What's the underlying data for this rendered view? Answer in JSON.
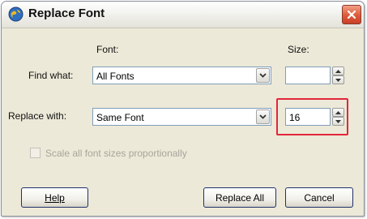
{
  "window": {
    "title": "Replace Font"
  },
  "headers": {
    "font": "Font:",
    "size": "Size:"
  },
  "find": {
    "label": "Find what:",
    "font_value": "All Fonts",
    "size_value": ""
  },
  "replace": {
    "label": "Replace with:",
    "font_value": "Same Font",
    "size_value": "16"
  },
  "options": {
    "scale_label": "Scale all font sizes proportionally",
    "scale_checked": false,
    "scale_enabled": false
  },
  "buttons": {
    "help": "Help",
    "replace_all": "Replace All",
    "cancel": "Cancel"
  },
  "icons": {
    "app": "app-globe-icon",
    "close": "close-icon",
    "dropdown": "chevron-down-icon",
    "spin_up": "spin-up-icon",
    "spin_down": "spin-down-icon"
  },
  "colors": {
    "highlight": "#e3263a",
    "close": "#dd5a38",
    "dialog_bg": "#ece9d8"
  }
}
